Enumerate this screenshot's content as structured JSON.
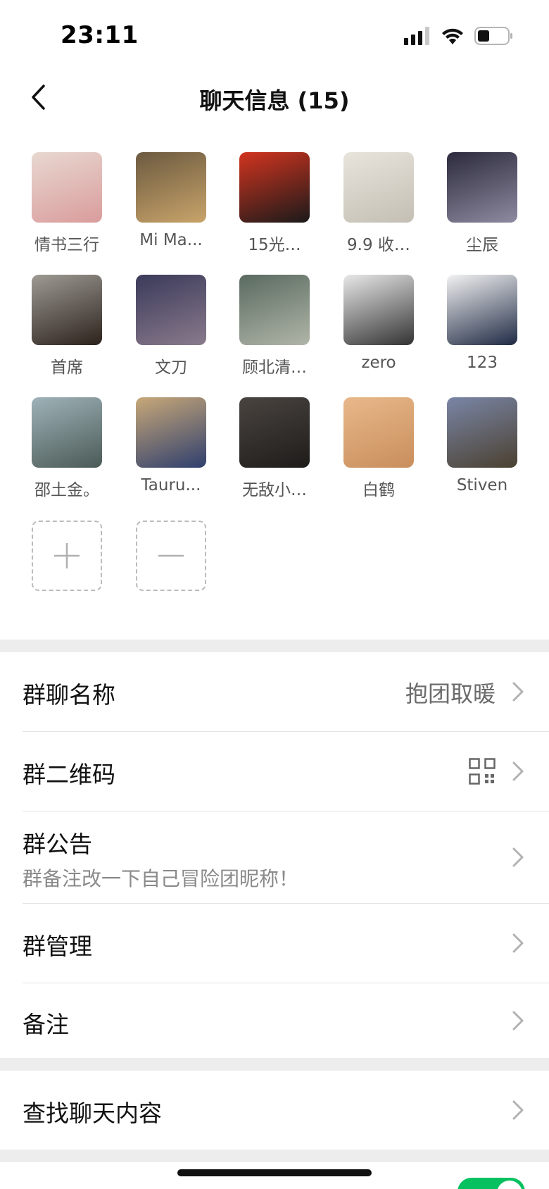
{
  "status_bar": {
    "time": "23:11"
  },
  "nav": {
    "title": "聊天信息 (15)"
  },
  "members": [
    {
      "name": "情书三行",
      "colors": [
        "#e8d8d0",
        "#d99c9c"
      ]
    },
    {
      "name": "Mi Ma...",
      "colors": [
        "#6b5a40",
        "#c9a46a"
      ]
    },
    {
      "name": "15光…",
      "colors": [
        "#d2341f",
        "#1a1a1a"
      ]
    },
    {
      "name": "9.9 收…",
      "colors": [
        "#e8e4dc",
        "#c4bfb4"
      ]
    },
    {
      "name": "尘辰",
      "colors": [
        "#2c2a3c",
        "#8e8aa0"
      ]
    },
    {
      "name": "首席",
      "colors": [
        "#9e9a94",
        "#2c221c"
      ]
    },
    {
      "name": "文刀",
      "colors": [
        "#3a3a5a",
        "#8a7a8c"
      ]
    },
    {
      "name": "顾北清…",
      "colors": [
        "#5a6a60",
        "#b0b6a8"
      ]
    },
    {
      "name": "zero",
      "colors": [
        "#e8e8e8",
        "#333333"
      ]
    },
    {
      "name": "123",
      "colors": [
        "#f2f2f2",
        "#1f2a44"
      ]
    },
    {
      "name": "邵土金。",
      "colors": [
        "#9fb2b8",
        "#4a5a56"
      ]
    },
    {
      "name": "Tauru...",
      "colors": [
        "#c8a878",
        "#2f3f6e"
      ]
    },
    {
      "name": "无敌小…",
      "colors": [
        "#4a4440",
        "#1e1c1a"
      ]
    },
    {
      "name": "白鹤",
      "colors": [
        "#e8b88a",
        "#c98e5c"
      ]
    },
    {
      "name": "Stiven",
      "colors": [
        "#7a86a6",
        "#4a4030"
      ]
    }
  ],
  "settings": {
    "group_name_label": "群聊名称",
    "group_name_value": "抱团取暖",
    "qr_label": "群二维码",
    "notice_label": "群公告",
    "notice_value": "群备注改一下自己冒险团昵称！",
    "manage_label": "群管理",
    "remark_label": "备注",
    "search_label": "查找聊天内容"
  },
  "colors": {
    "toggle_on": "#07c160",
    "page_bg": "#ededed"
  }
}
